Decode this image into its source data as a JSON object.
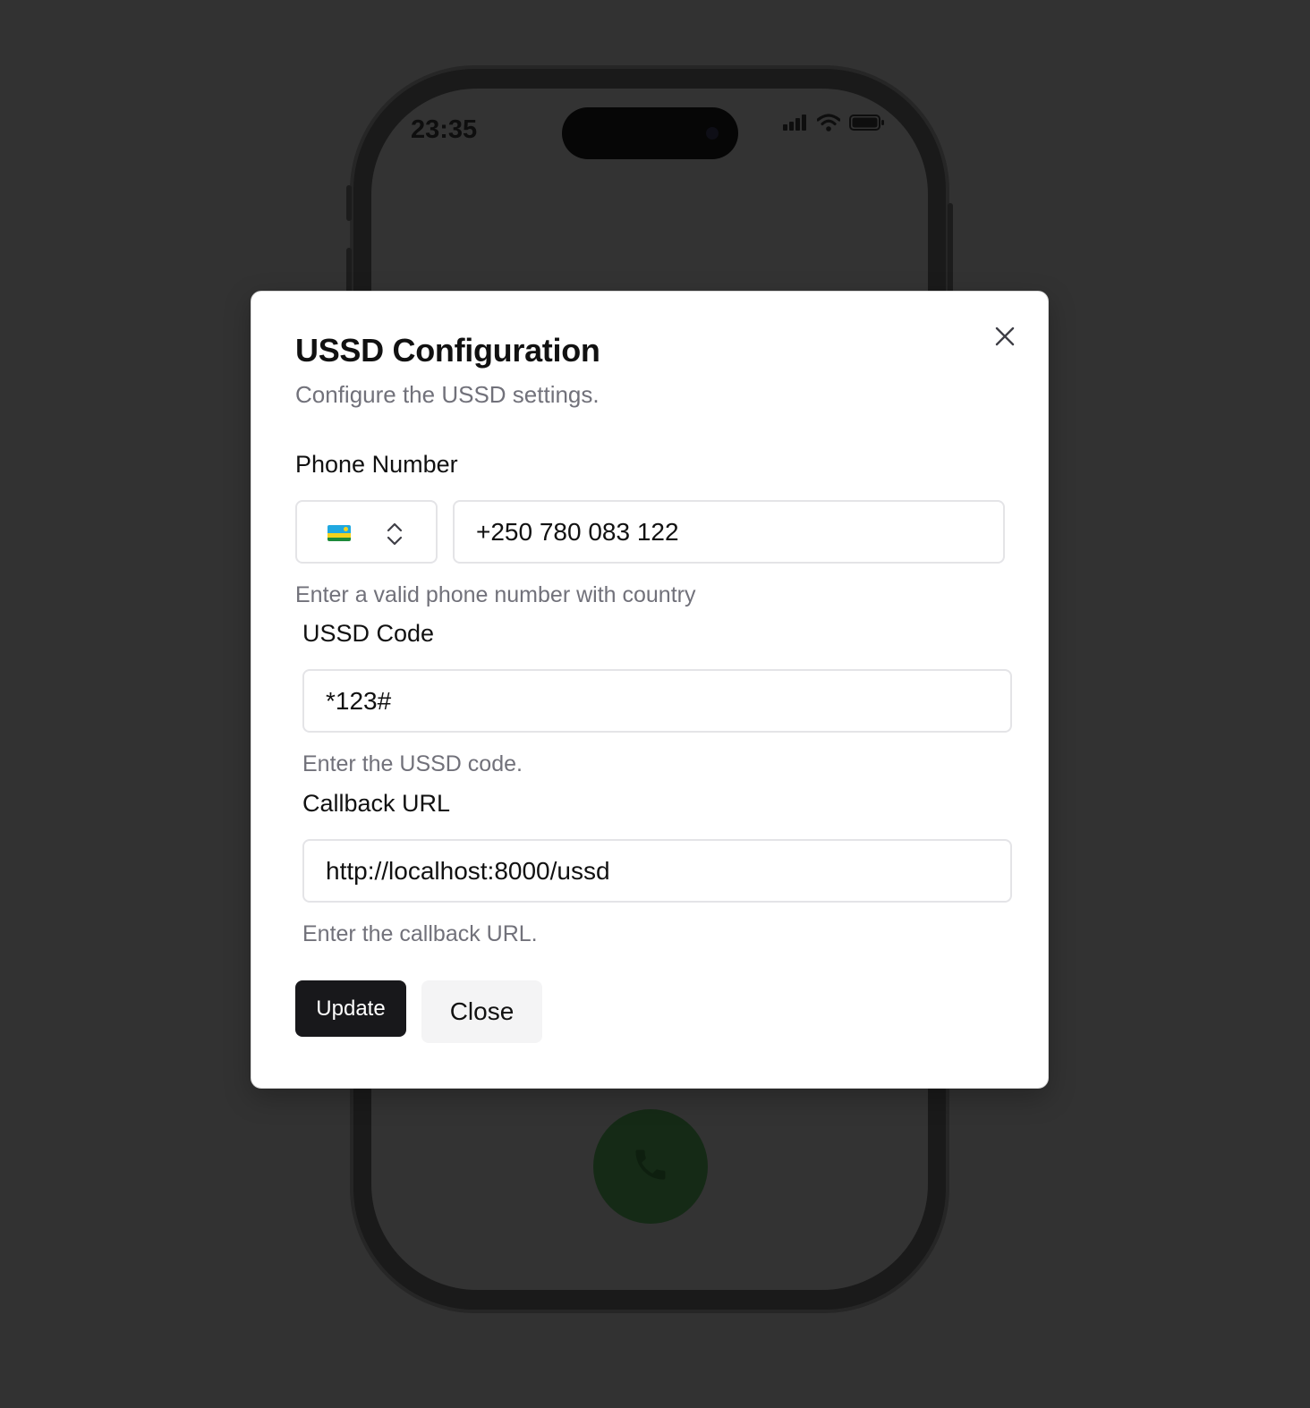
{
  "phone": {
    "status_time": "23:35",
    "status_icons": [
      "signal-icon",
      "wifi-icon",
      "battery-icon"
    ],
    "call_icon": "phone-icon"
  },
  "modal": {
    "title": "USSD Configuration",
    "subtitle": "Configure the USSD settings.",
    "close_icon": "close-icon",
    "phone_number": {
      "label": "Phone Number",
      "country_flag": "Rwanda flag",
      "value": "+250 780 083 122",
      "helper": "Enter a valid phone number with country"
    },
    "ussd_code": {
      "label": "USSD Code",
      "value": "*123#",
      "helper": "Enter the USSD code."
    },
    "callback_url": {
      "label": "Callback URL",
      "value": "http://localhost:8000/ussd",
      "helper": "Enter the callback URL."
    },
    "buttons": {
      "update": "Update",
      "close": "Close"
    }
  },
  "colors": {
    "backdrop": "#323232",
    "primary_button": "#18181b",
    "secondary_button": "#f4f4f5",
    "muted_text": "#71717a",
    "call_button": "#152a16"
  }
}
